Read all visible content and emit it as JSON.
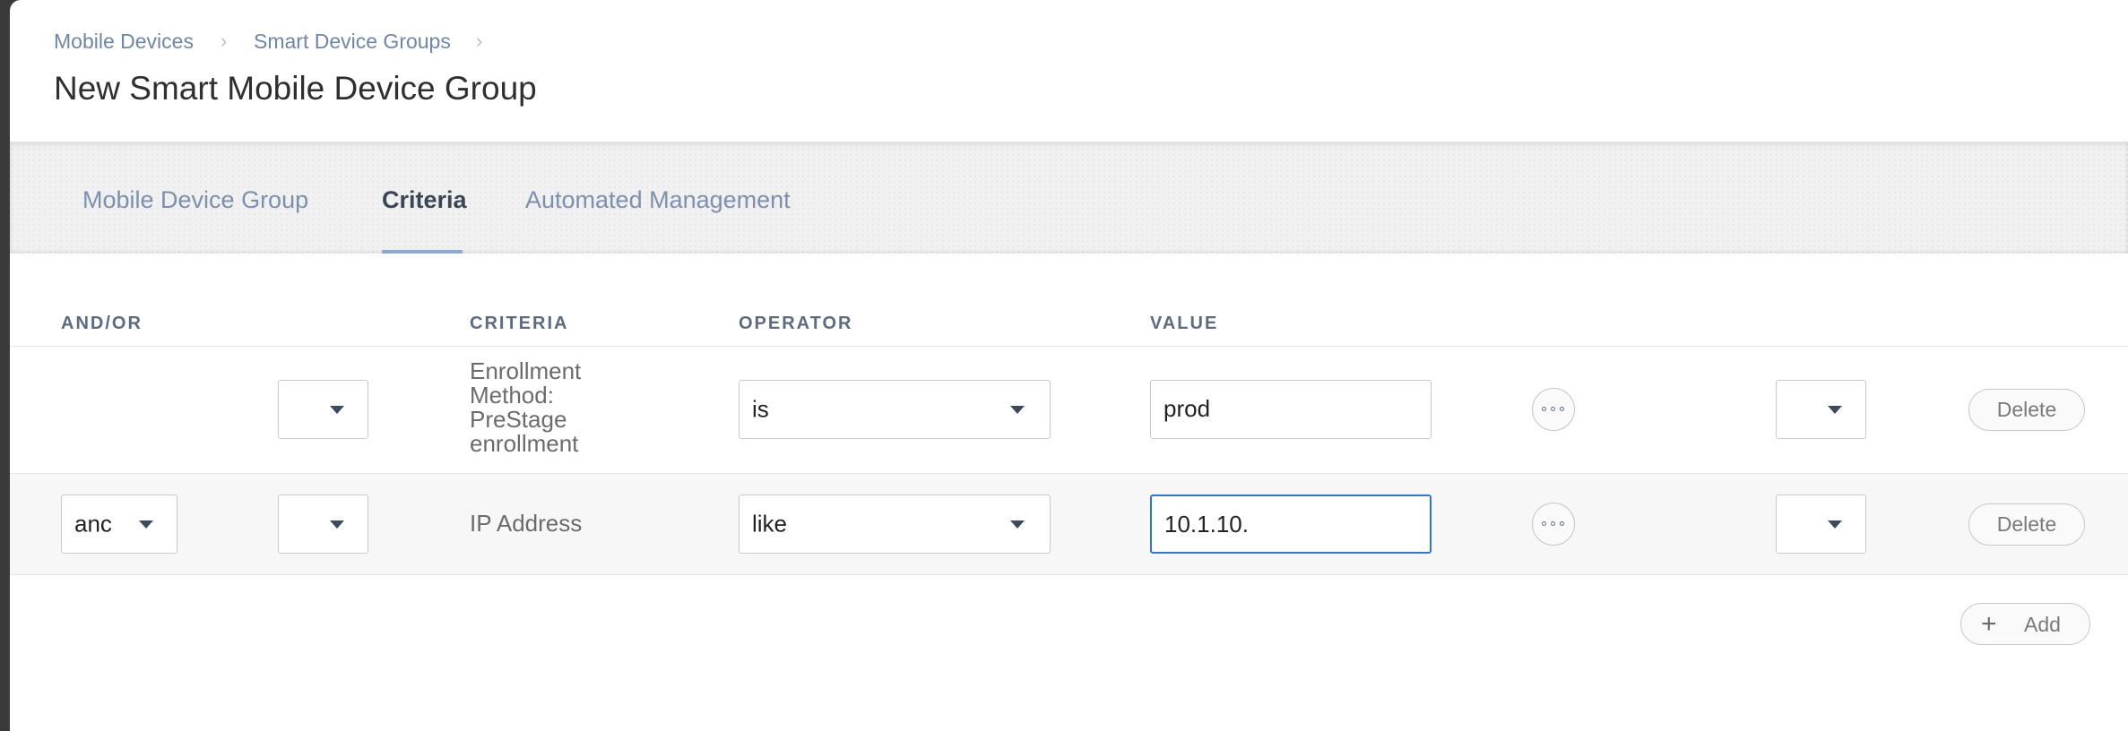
{
  "breadcrumb": {
    "items": [
      "Mobile Devices",
      "Smart Device Groups"
    ],
    "separator": "›"
  },
  "page_title": "New Smart Mobile Device Group",
  "tabs": [
    {
      "label": "Mobile Device Group",
      "active": false
    },
    {
      "label": "Criteria",
      "active": true
    },
    {
      "label": "Automated Management",
      "active": false
    }
  ],
  "table": {
    "headers": {
      "and_or": "AND/OR",
      "criteria": "CRITERIA",
      "operator": "OPERATOR",
      "value": "VALUE"
    },
    "rows": [
      {
        "and_or": "",
        "open_paren": "",
        "criteria": "Enrollment Method: PreStage enrollment",
        "operator": "is",
        "value": "prod",
        "close_paren": "",
        "delete_label": "Delete"
      },
      {
        "and_or": "anc",
        "open_paren": "",
        "criteria": "IP Address",
        "operator": "like",
        "value": "10.1.10.",
        "close_paren": "",
        "delete_label": "Delete"
      }
    ]
  },
  "add_button": {
    "icon": "+",
    "label": "Add"
  },
  "colors": {
    "accent": "#2b78d6",
    "link": "#6f86a6",
    "tab_underline": "#8aa9d6"
  }
}
